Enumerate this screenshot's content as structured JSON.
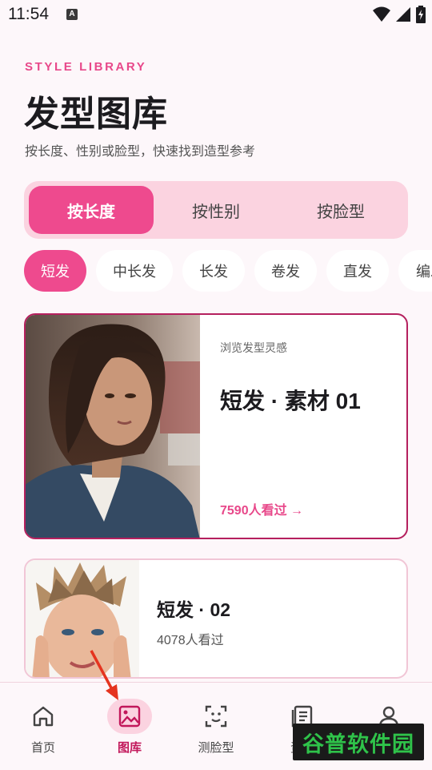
{
  "status": {
    "time": "11:54"
  },
  "header": {
    "eyebrow": "STYLE LIBRARY",
    "title": "发型图库",
    "subtitle": "按长度、性别或脸型，快速找到造型参考"
  },
  "segments": [
    {
      "label": "按长度",
      "active": true
    },
    {
      "label": "按性别",
      "active": false
    },
    {
      "label": "按脸型",
      "active": false
    }
  ],
  "chips": [
    {
      "label": "短发",
      "active": true
    },
    {
      "label": "中长发",
      "active": false
    },
    {
      "label": "长发",
      "active": false
    },
    {
      "label": "卷发",
      "active": false
    },
    {
      "label": "直发",
      "active": false
    },
    {
      "label": "编发",
      "active": false
    }
  ],
  "cards": [
    {
      "kicker": "浏览发型灵感",
      "title": "短发 · 素材 01",
      "views": "7590人看过 →"
    },
    {
      "title": "短发 · 02",
      "views": "4078人看过"
    }
  ],
  "nav": [
    {
      "label": "首页",
      "icon": "home-icon",
      "active": false
    },
    {
      "label": "图库",
      "icon": "gallery-icon",
      "active": true
    },
    {
      "label": "测脸型",
      "icon": "face-scan-icon",
      "active": false
    },
    {
      "label": "资讯",
      "icon": "document-icon",
      "active": false
    },
    {
      "label": "我的",
      "icon": "user-icon",
      "active": false
    }
  ],
  "watermark": "谷普软件园",
  "colors": {
    "accent": "#ee4a8e",
    "accent_soft": "#fbd3e0",
    "card_border": "#b5205e",
    "background": "#fdf7fa"
  }
}
